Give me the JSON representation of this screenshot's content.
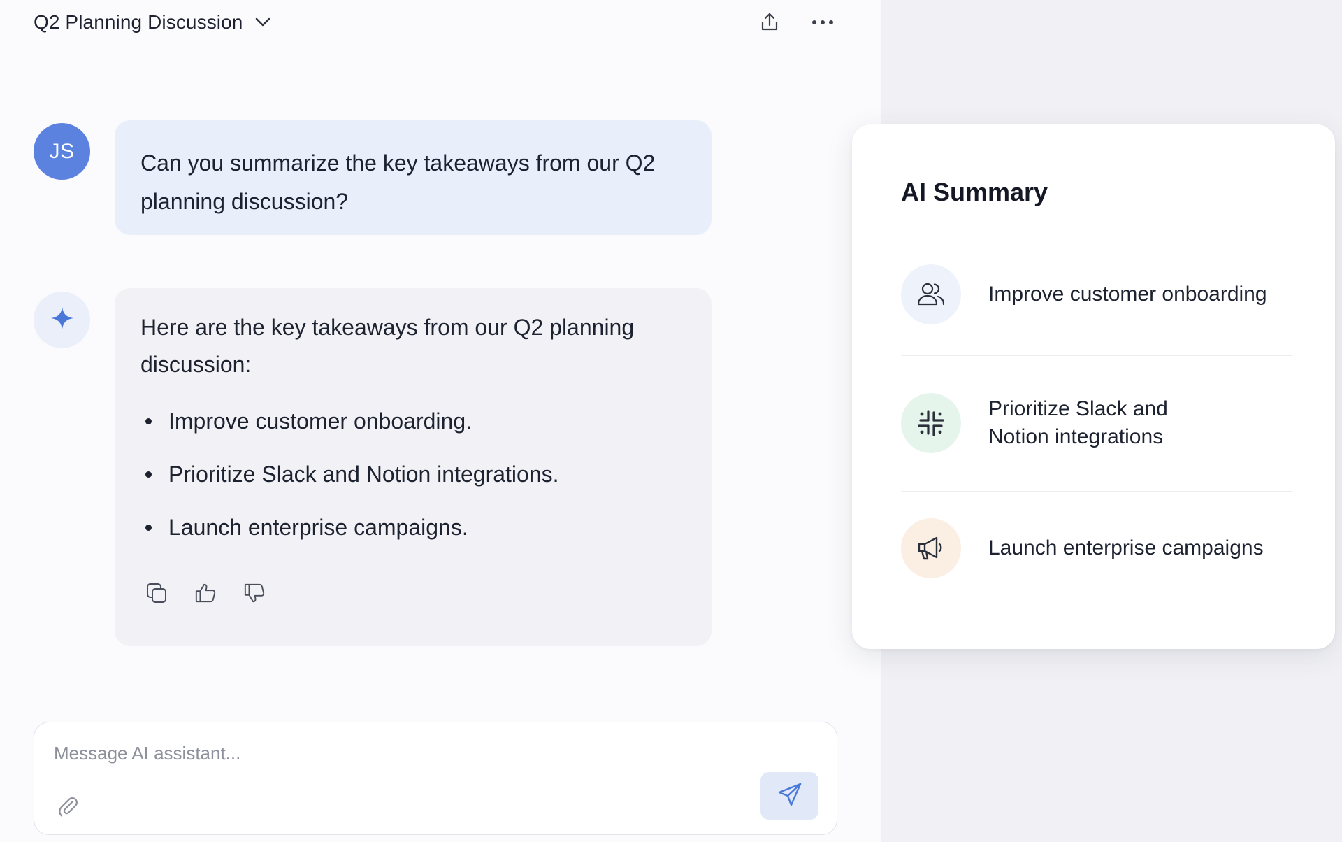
{
  "header": {
    "title": "Q2 Planning Discussion",
    "share_icon": "share-icon",
    "more_icon": "more-icon"
  },
  "messages": {
    "user": {
      "avatar_initials": "JS",
      "text": "Can you summarize the key takeaways from our Q2 planning discussion?"
    },
    "assistant": {
      "avatar_icon": "sparkle-icon",
      "intro": "Here are the key takeaways from our Q2 planning discussion:",
      "bullets": [
        "Improve customer onboarding.",
        "Prioritize Slack and Notion integrations.",
        "Launch enterprise campaigns."
      ],
      "actions": [
        "copy-icon",
        "thumbs-up-icon",
        "thumbs-down-icon"
      ]
    }
  },
  "composer": {
    "placeholder": "Message AI assistant...",
    "value": "",
    "attach_icon": "paperclip-icon",
    "send_icon": "send-icon"
  },
  "summary": {
    "title": "AI Summary",
    "items": [
      {
        "icon": "users-icon",
        "text": "Improve customer onboarding",
        "color": "#eef2fb"
      },
      {
        "icon": "slack-icon",
        "text": "Prioritize Slack and Notion integrations",
        "color": "#e6f5ec"
      },
      {
        "icon": "megaphone-icon",
        "text": "Launch enterprise campaigns",
        "color": "#fbeee3"
      }
    ]
  },
  "colors": {
    "user_avatar": "#5b82df",
    "user_bubble": "#e9eefb",
    "assistant_bubble": "#f2f2f6",
    "accent": "#4a78d8"
  }
}
